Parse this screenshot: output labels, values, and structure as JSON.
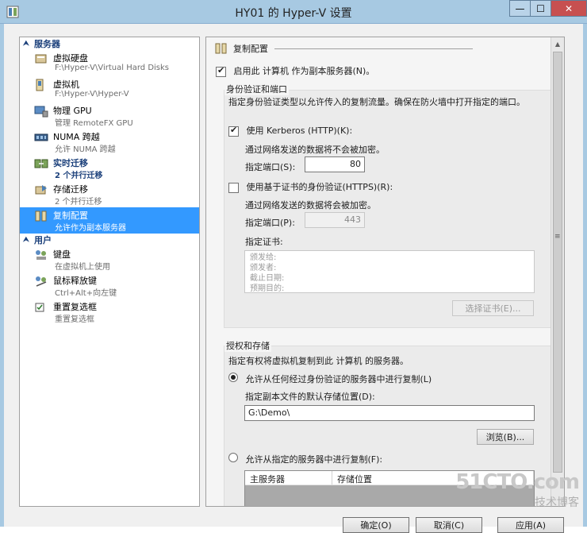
{
  "window": {
    "title": "HY01 的 Hyper-V 设置",
    "minimize": "—",
    "maximize": "☐",
    "close": "✕"
  },
  "nav": {
    "section_server": "服务器",
    "section_user": "用户",
    "items": [
      {
        "label": "虚拟硬盘",
        "sub": "F:\\Hyper-V\\Virtual Hard Disks",
        "icon": "virtual-disk-icon"
      },
      {
        "label": "虚拟机",
        "sub": "F:\\Hyper-V\\Hyper-V",
        "icon": "virtual-machine-icon"
      },
      {
        "label": "物理 GPU",
        "sub": "管理 RemoteFX GPU",
        "icon": "gpu-icon"
      },
      {
        "label": "NUMA 跨越",
        "sub": "允许 NUMA 跨越",
        "icon": "numa-icon"
      },
      {
        "label": "实时迁移",
        "sub": "2 个并行迁移",
        "icon": "live-migration-icon"
      },
      {
        "label": "存储迁移",
        "sub": "2 个并行迁移",
        "icon": "storage-migration-icon"
      },
      {
        "label": "复制配置",
        "sub": "允许作为副本服务器",
        "icon": "replication-icon"
      },
      {
        "label": "键盘",
        "sub": "在虚拟机上使用",
        "icon": "keyboard-icon"
      },
      {
        "label": "鼠标释放键",
        "sub": "Ctrl+Alt+向左键",
        "icon": "mouse-release-icon"
      },
      {
        "label": "重置复选框",
        "sub": "重置复选框",
        "icon": "reset-checkbox-icon"
      }
    ]
  },
  "content": {
    "header": "复制配置",
    "enable_replica": "启用此 计算机 作为副本服务器(N)。",
    "auth_group": {
      "title": "身份验证和端口",
      "desc": "指定身份验证类型以允许传入的复制流量。确保在防火墙中打开指定的端口。",
      "kerberos_label": "使用 Kerberos (HTTP)(K):",
      "kerberos_note": "通过网络发送的数据将不会被加密。",
      "kerberos_port_label": "指定端口(S):",
      "kerberos_port": "80",
      "cert_label": "使用基于证书的身份验证(HTTPS)(R):",
      "cert_note": "通过网络发送的数据将会被加密。",
      "cert_port_label": "指定端口(P):",
      "cert_port": "443",
      "cert_field_label": "指定证书:",
      "cert_lines": [
        "颁发给:",
        "颁发者:",
        "截止日期:",
        "预期目的:"
      ],
      "select_cert_btn": "选择证书(E)..."
    },
    "storage_group": {
      "title": "授权和存储",
      "desc": "指定有权将虚拟机复制到此 计算机 的服务器。",
      "allow_any": "允许从任何经过身份验证的服务器中进行复制(L)",
      "default_location_label": "指定副本文件的默认存储位置(D):",
      "default_location": "G:\\Demo\\",
      "browse_btn": "浏览(B)...",
      "allow_specified": "允许从指定的服务器中进行复制(F):",
      "table_headers": [
        "主服务器",
        "存储位置"
      ]
    }
  },
  "footer": {
    "ok": "确定(O)",
    "cancel": "取消(C)",
    "apply": "应用(A)"
  },
  "watermark": {
    "brand": "51CTO.com",
    "sub": "技术博客"
  }
}
